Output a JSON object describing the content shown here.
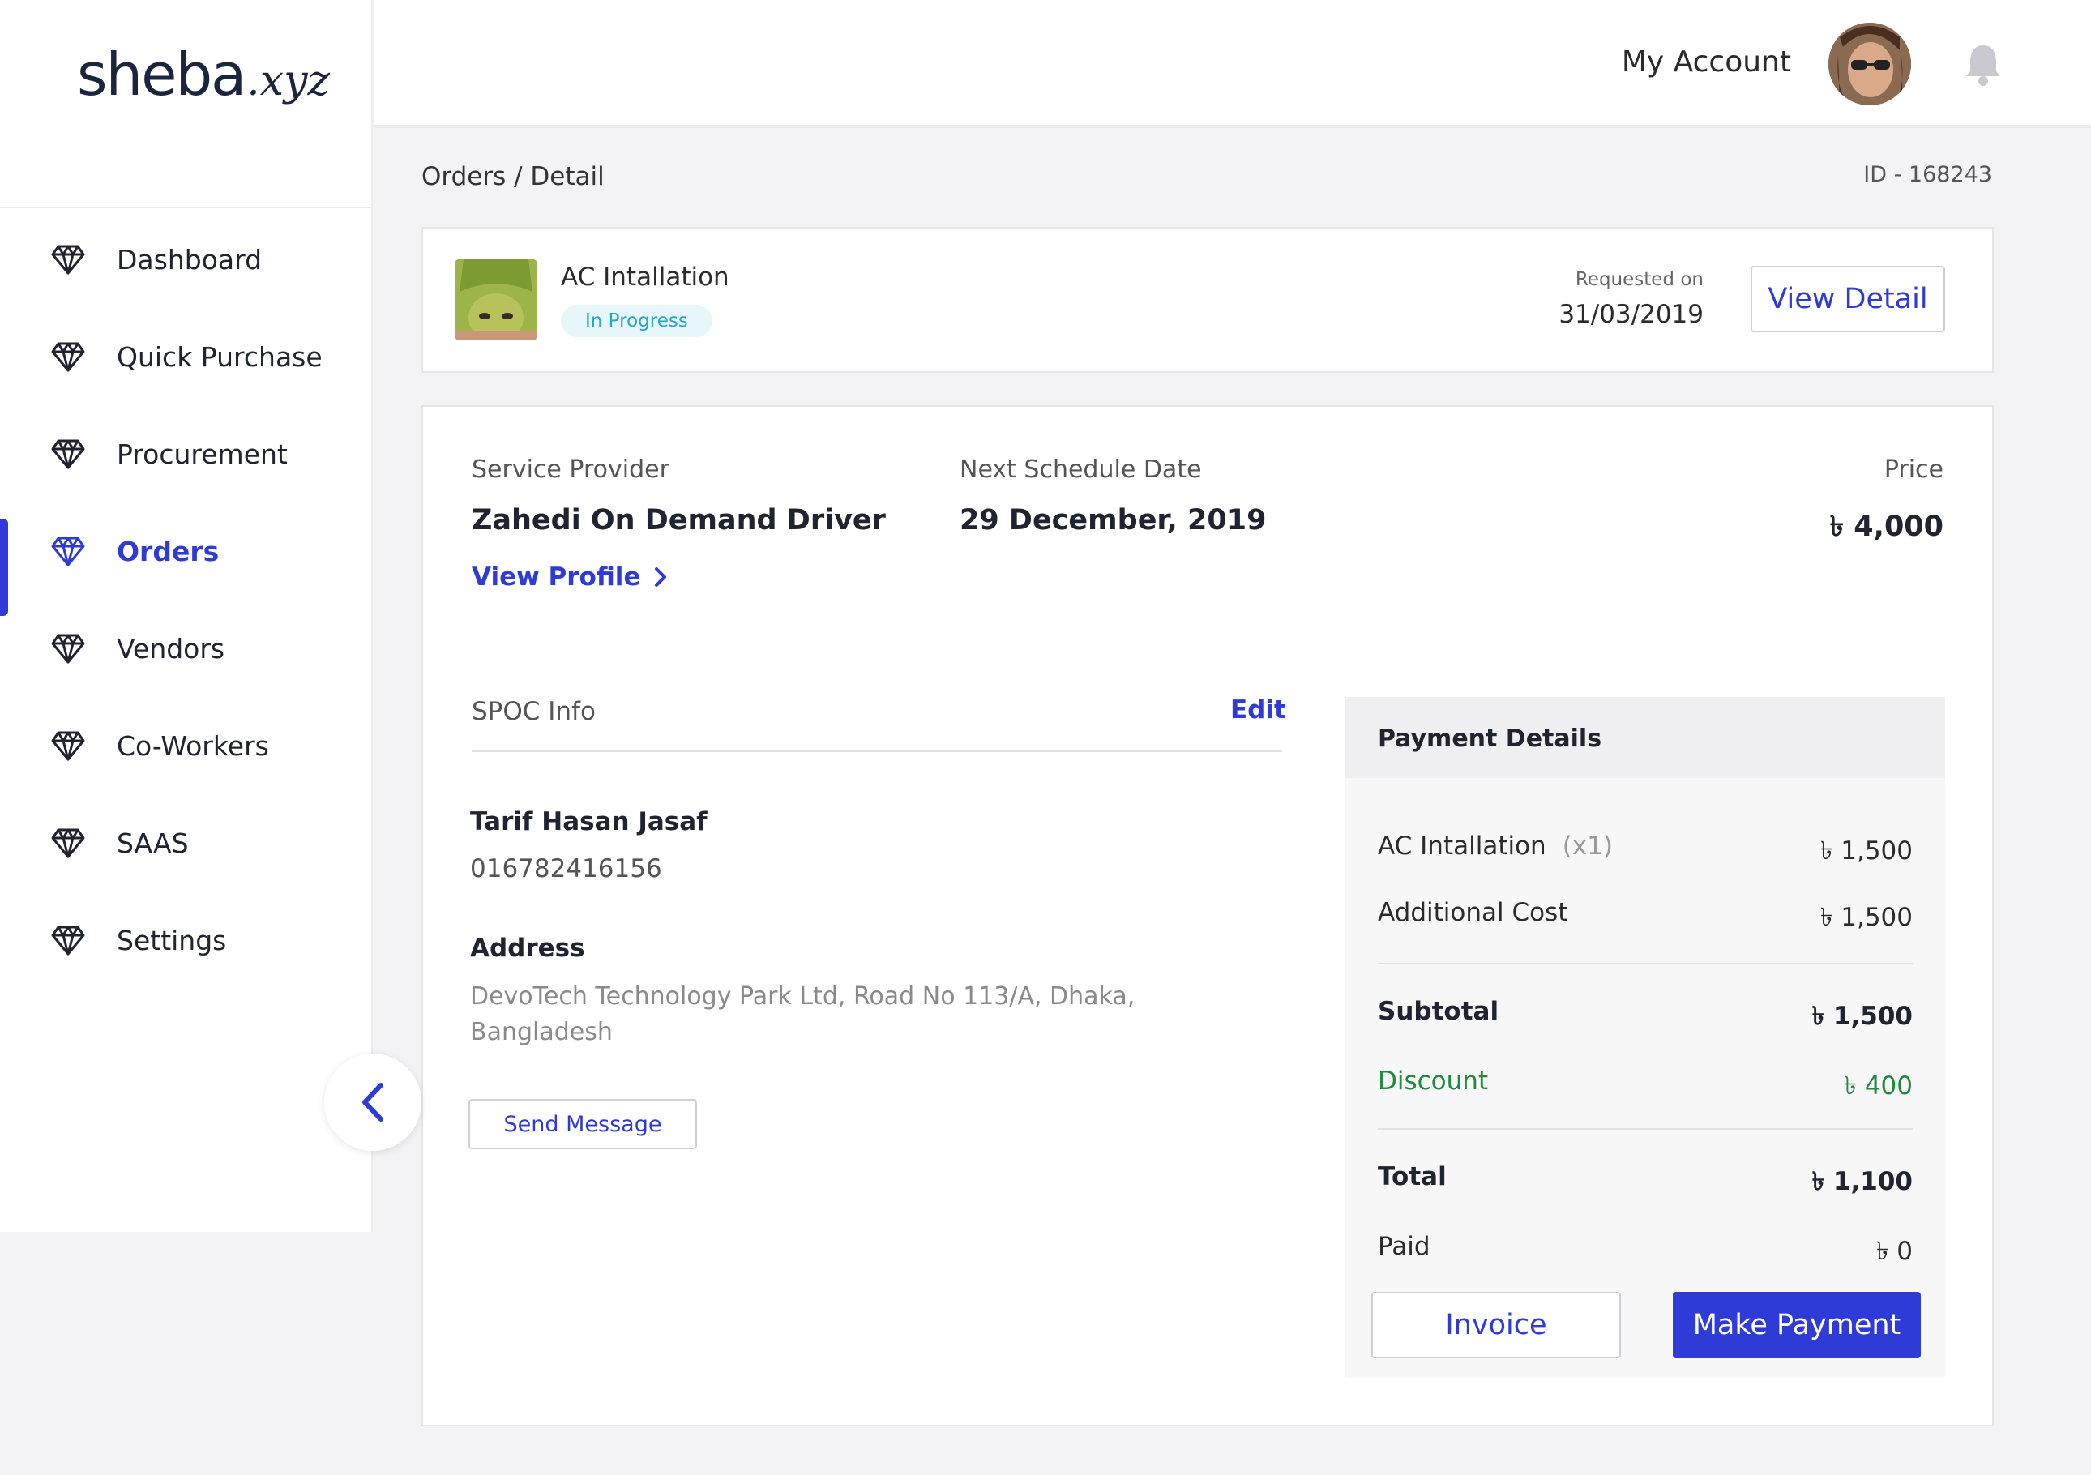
{
  "brand": {
    "name": "sheba",
    "suffix": ".xyz"
  },
  "sidebar": {
    "items": [
      {
        "label": "Dashboard",
        "icon": "diamond-icon",
        "active": false
      },
      {
        "label": "Quick Purchase",
        "icon": "diamond-icon",
        "active": false
      },
      {
        "label": "Procurement",
        "icon": "diamond-icon",
        "active": false
      },
      {
        "label": "Orders",
        "icon": "diamond-icon",
        "active": true
      },
      {
        "label": "Vendors",
        "icon": "diamond-icon",
        "active": false
      },
      {
        "label": "Co-Workers",
        "icon": "diamond-icon",
        "active": false
      },
      {
        "label": "SAAS",
        "icon": "diamond-icon",
        "active": false
      },
      {
        "label": "Settings",
        "icon": "diamond-icon",
        "active": false
      }
    ],
    "collapse_icon": "chevron-left-icon"
  },
  "header": {
    "account_label": "My Account",
    "avatar_icon": "user-avatar",
    "bell_icon": "bell-icon"
  },
  "page": {
    "breadcrumb": "Orders / Detail",
    "order_id": "ID - 168243"
  },
  "order": {
    "title": "AC Intallation",
    "status": "In Progress",
    "requested_label": "Requested on",
    "requested_date": "31/03/2019",
    "view_detail": "View Detail"
  },
  "details": {
    "provider_label": "Service Provider",
    "provider_name": "Zahedi On Demand Driver",
    "view_profile": "View Profile",
    "schedule_label": "Next Schedule Date",
    "schedule_date": "29 December, 2019",
    "price_label": "Price",
    "price_value": "৳ 4,000"
  },
  "spoc": {
    "label": "SPOC Info",
    "edit": "Edit",
    "name": "Tarif Hasan Jasaf",
    "phone": "016782416156",
    "address_label": "Address",
    "address": "DevoTech Technology Park Ltd, Road No 113/A, Dhaka, Bangladesh",
    "send_message": "Send Message"
  },
  "payment": {
    "title": "Payment Details",
    "item_label": "AC Intallation",
    "item_qty": "(x1)",
    "item_value": "৳ 1,500",
    "additional_label": "Additional Cost",
    "additional_value": "৳ 1,500",
    "subtotal_label": "Subtotal",
    "subtotal_value": "৳ 1,500",
    "discount_label": "Discount",
    "discount_value": "৳ 400",
    "total_label": "Total",
    "total_value": "৳ 1,100",
    "paid_label": "Paid",
    "paid_value": "৳ 0",
    "invoice_button": "Invoice",
    "make_payment_button": "Make Payment"
  },
  "colors": {
    "accent": "#2f3bd6",
    "discount": "#1f8a3a",
    "status_bg": "#e6f6f9",
    "status_text": "#26a6c9"
  }
}
